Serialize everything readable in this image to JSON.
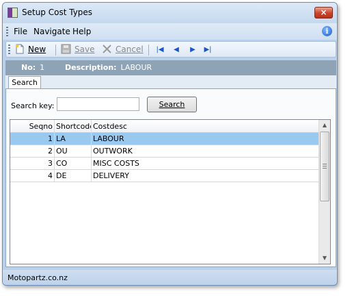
{
  "window": {
    "title": "Setup Cost Types",
    "close_icon": "×"
  },
  "menu": {
    "items": [
      "File",
      "Navigate",
      "Help"
    ]
  },
  "toolbar": {
    "new_label": "New",
    "save_label": "Save",
    "cancel_label": "Cancel",
    "nav_icons": [
      "first-record-icon",
      "previous-record-icon",
      "next-record-icon",
      "last-record-icon"
    ]
  },
  "header": {
    "no_label": "No:",
    "no_value": "1",
    "desc_label": "Description:",
    "desc_value": "LABOUR"
  },
  "tabs": [
    {
      "label": "Search"
    }
  ],
  "search": {
    "label": "Search key:",
    "value": "",
    "button_label": "Search"
  },
  "grid": {
    "columns": [
      "Seqno",
      "Shortcode",
      "Costdesc"
    ],
    "rows": [
      {
        "seqno": "1",
        "shortcode": "LA",
        "costdesc": "LABOUR",
        "selected": true
      },
      {
        "seqno": "2",
        "shortcode": "OU",
        "costdesc": "OUTWORK",
        "selected": false
      },
      {
        "seqno": "3",
        "shortcode": "CO",
        "costdesc": "MISC COSTS",
        "selected": false
      },
      {
        "seqno": "4",
        "shortcode": "DE",
        "costdesc": "DELIVERY",
        "selected": false
      }
    ]
  },
  "status": {
    "text": "Motopartz.co.nz"
  },
  "colors": {
    "selection": "#99c9ef",
    "header_band": "#8fa3b7",
    "window_frame": "#b9d1ea"
  }
}
